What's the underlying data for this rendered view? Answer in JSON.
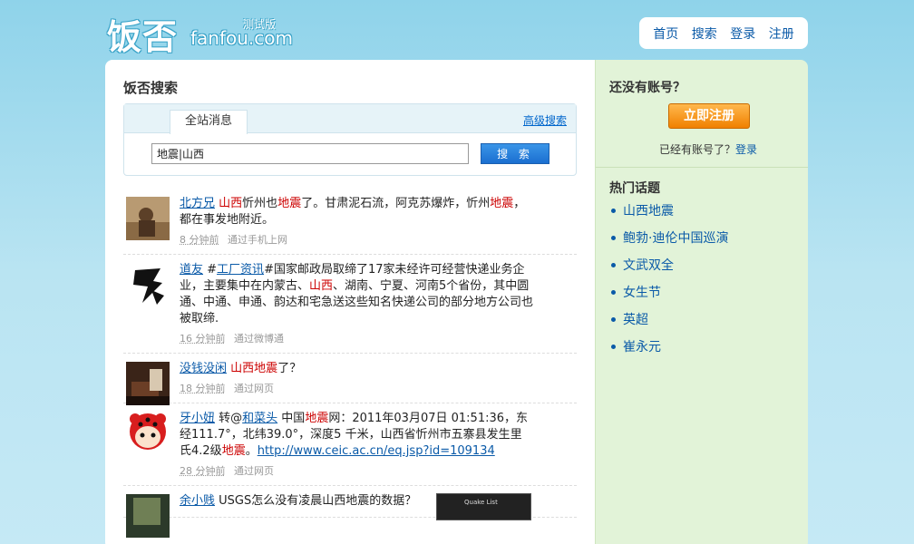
{
  "logo": {
    "cn": "饭否",
    "en": "fanfou.com",
    "beta": "测试版"
  },
  "nav": [
    "首页",
    "搜索",
    "登录",
    "注册"
  ],
  "main": {
    "title": "饭否搜索",
    "search": {
      "tab": "全站消息",
      "advanced": "高级搜索",
      "query": "地震|山西",
      "button": "搜 索"
    }
  },
  "messages": [
    {
      "user": "北方兄",
      "segments": [
        {
          "t": " ",
          "k": "plain"
        },
        {
          "t": "山西",
          "k": "hl"
        },
        {
          "t": "忻州也",
          "k": "plain"
        },
        {
          "t": "地震",
          "k": "hl"
        },
        {
          "t": "了。甘肃泥石流，阿克苏爆炸，忻州",
          "k": "plain"
        },
        {
          "t": "地震",
          "k": "hl"
        },
        {
          "t": "，都在事发地附近。",
          "k": "plain"
        }
      ],
      "time": "8 分钟前",
      "via": "通过手机上网"
    },
    {
      "user": "道友",
      "segments": [
        {
          "t": " #",
          "k": "plain"
        },
        {
          "t": "工厂资讯",
          "k": "link"
        },
        {
          "t": "#国家邮政局取缔了17家未经许可经营快递业务企业，主要集中在内蒙古、",
          "k": "plain"
        },
        {
          "t": "山西",
          "k": "hl"
        },
        {
          "t": "、湖南、宁夏、河南5个省份，其中圆通、中通、申通、韵达和宅急送这些知名快递公司的部分地方公司也被取缔.",
          "k": "plain"
        }
      ],
      "time": "16 分钟前",
      "via": "通过微博通"
    },
    {
      "user": "没钱没闲",
      "segments": [
        {
          "t": " ",
          "k": "plain"
        },
        {
          "t": "山西",
          "k": "hl"
        },
        {
          "t": "地震",
          "k": "hl"
        },
        {
          "t": "了？",
          "k": "plain"
        }
      ],
      "time": "18 分钟前",
      "via": "通过网页"
    },
    {
      "user": "牙小妞",
      "segments": [
        {
          "t": " 转@",
          "k": "plain"
        },
        {
          "t": "和菜头",
          "k": "link"
        },
        {
          "t": " 中国",
          "k": "plain"
        },
        {
          "t": "地震",
          "k": "hl"
        },
        {
          "t": "网：2011年03月07日 01:51:36，东经111.7°，北纬39.0°，深度5 千米，山西省忻州市五寨县发生里氏4.2级",
          "k": "plain"
        },
        {
          "t": "地震",
          "k": "hl"
        },
        {
          "t": "。",
          "k": "plain"
        },
        {
          "t": "http://www.ceic.ac.cn/eq.jsp?id=109134",
          "k": "link"
        }
      ],
      "time": "28 分钟前",
      "via": "通过网页"
    },
    {
      "user": "余小贱",
      "segments": [
        {
          "t": " USGS怎么没有凌晨山西地震的数据？",
          "k": "plain"
        }
      ],
      "time": "",
      "via": "",
      "thumb_title": "Quake List"
    }
  ],
  "sidebar": {
    "no_account": "还没有账号？",
    "signup_button": "立即注册",
    "have_account": "已经有账号了？",
    "login_link": "登录",
    "topics_title": "热门话题",
    "topics": [
      "山西地震",
      "鲍勃·迪伦中国巡演",
      "文武双全",
      "女生节",
      "英超",
      "崔永元"
    ]
  }
}
